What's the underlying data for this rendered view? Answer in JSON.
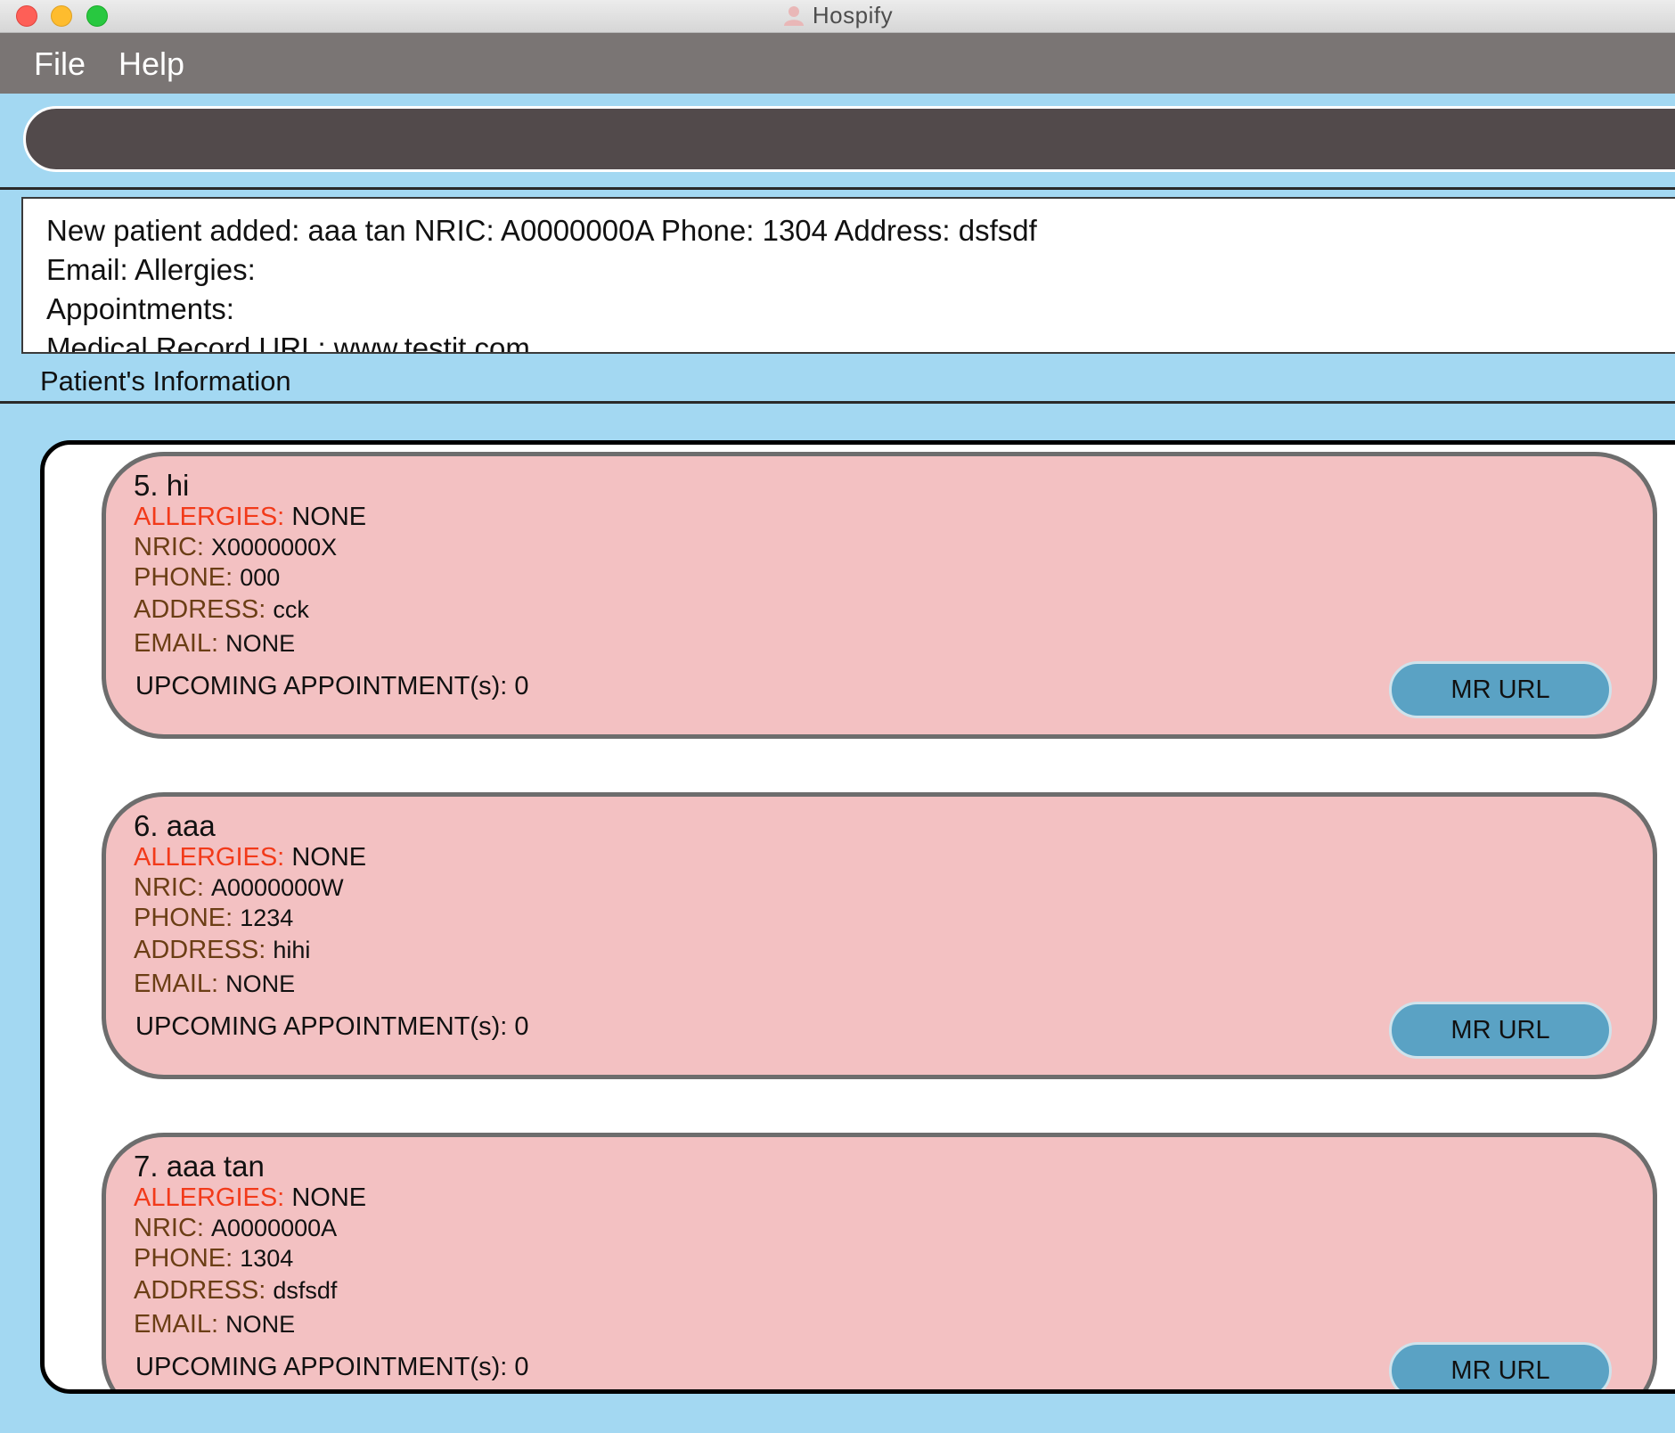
{
  "window": {
    "title": "Hospify"
  },
  "menu": {
    "file": "File",
    "help": "Help"
  },
  "command": {
    "value": "",
    "placeholder": ""
  },
  "result": {
    "lines": [
      "New patient added: aaa tan NRIC: A0000000A Phone: 1304 Address: dsfsdf",
      "Email:  Allergies:",
      "Appointments:",
      "Medical Record URL: www.testit.com"
    ]
  },
  "list": {
    "label": "Patient's Information",
    "labels": {
      "allergies": "ALLERGIES:",
      "nric": "NRIC:",
      "phone": "PHONE:",
      "address": "ADDRESS:",
      "email": "EMAIL:",
      "mr_button": "MR URL"
    },
    "patients": [
      {
        "title": "5.  hi",
        "allergies": "NONE",
        "nric": "X0000000X",
        "phone": "000",
        "address": "cck",
        "email": "NONE",
        "upcoming": "UPCOMING APPOINTMENT(s): 0"
      },
      {
        "title": "6.  aaa",
        "allergies": "NONE",
        "nric": "A0000000W",
        "phone": "1234",
        "address": "hihi",
        "email": "NONE",
        "upcoming": "UPCOMING APPOINTMENT(s): 0"
      },
      {
        "title": "7.  aaa tan",
        "allergies": "NONE",
        "nric": "A0000000A",
        "phone": "1304",
        "address": "dsfsdf",
        "email": "NONE",
        "upcoming": "UPCOMING APPOINTMENT(s): 0"
      }
    ]
  },
  "colors": {
    "background": "#a3d8f2",
    "menubar": "#7a7574",
    "command_box": "#524a4b",
    "card": "#f3c1c2",
    "allergy_label": "#f23a1a",
    "field_label": "#6b3e15",
    "button": "#5aa2c4"
  }
}
